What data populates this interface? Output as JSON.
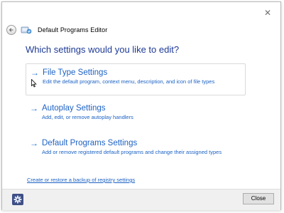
{
  "window": {
    "title": "Default Programs Editor",
    "close_glyph": "✕"
  },
  "main": {
    "heading": "Which settings would you like to edit?",
    "arrow_glyph": "→",
    "options": [
      {
        "label": "File Type Settings",
        "description": "Edit the default program, context menu, description, and icon of file types"
      },
      {
        "label": "Autoplay Settings",
        "description": "Add, edit, or remove autoplay handlers"
      },
      {
        "label": "Default Programs Settings",
        "description": "Add or remove registered default programs and change their assigned types"
      }
    ],
    "backup_link": "Create or restore a backup of registry settings"
  },
  "footer": {
    "close_label": "Close"
  },
  "colors": {
    "heading": "#1e3a96",
    "link": "#1c62c4",
    "accent": "#1c6fd1"
  },
  "icons": [
    "back-arrow-icon",
    "default-programs-app-icon",
    "close-icon",
    "settings-gear-icon",
    "mouse-cursor-icon"
  ]
}
